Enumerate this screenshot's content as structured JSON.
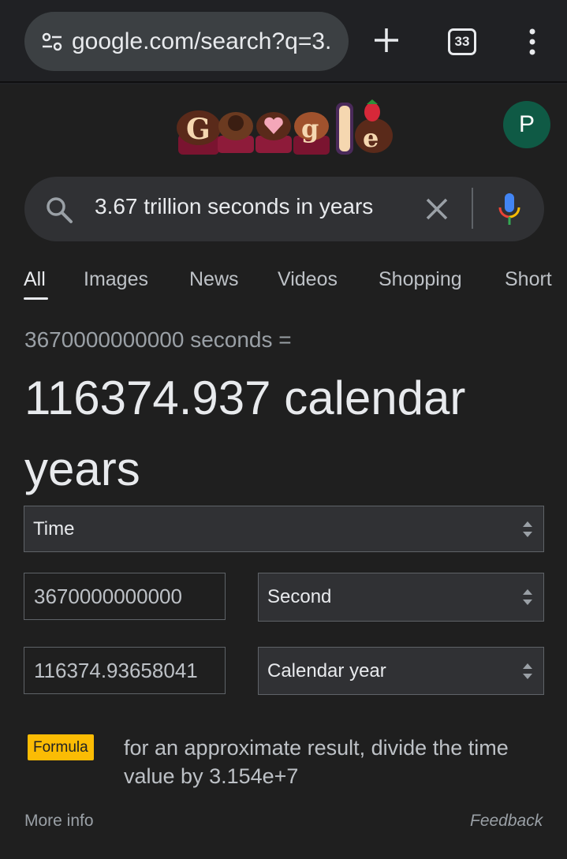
{
  "browser": {
    "url": "google.com/search?q=3.",
    "tab_count": "33"
  },
  "account": {
    "avatar_letter": "P"
  },
  "search": {
    "query": "3.67 trillion seconds in years"
  },
  "nav_tabs": [
    {
      "label": "All",
      "active": true
    },
    {
      "label": "Images"
    },
    {
      "label": "News"
    },
    {
      "label": "Videos"
    },
    {
      "label": "Shopping"
    },
    {
      "label": "Short"
    }
  ],
  "converter": {
    "from_line": "3670000000000 seconds =",
    "result_line": "116374.937 calendar years",
    "category": "Time",
    "from_value": "3670000000000",
    "from_unit": "Second",
    "to_value": "116374.93658041",
    "to_unit": "Calendar year"
  },
  "formula": {
    "badge": "Formula",
    "text": "for an approximate result, divide the time value by 3.154e+7"
  },
  "footer": {
    "more_info": "More info",
    "feedback": "Feedback"
  },
  "colors": {
    "background": "#1f1f1f",
    "accent_badge": "#fbbc04",
    "avatar": "#0f5a45"
  }
}
